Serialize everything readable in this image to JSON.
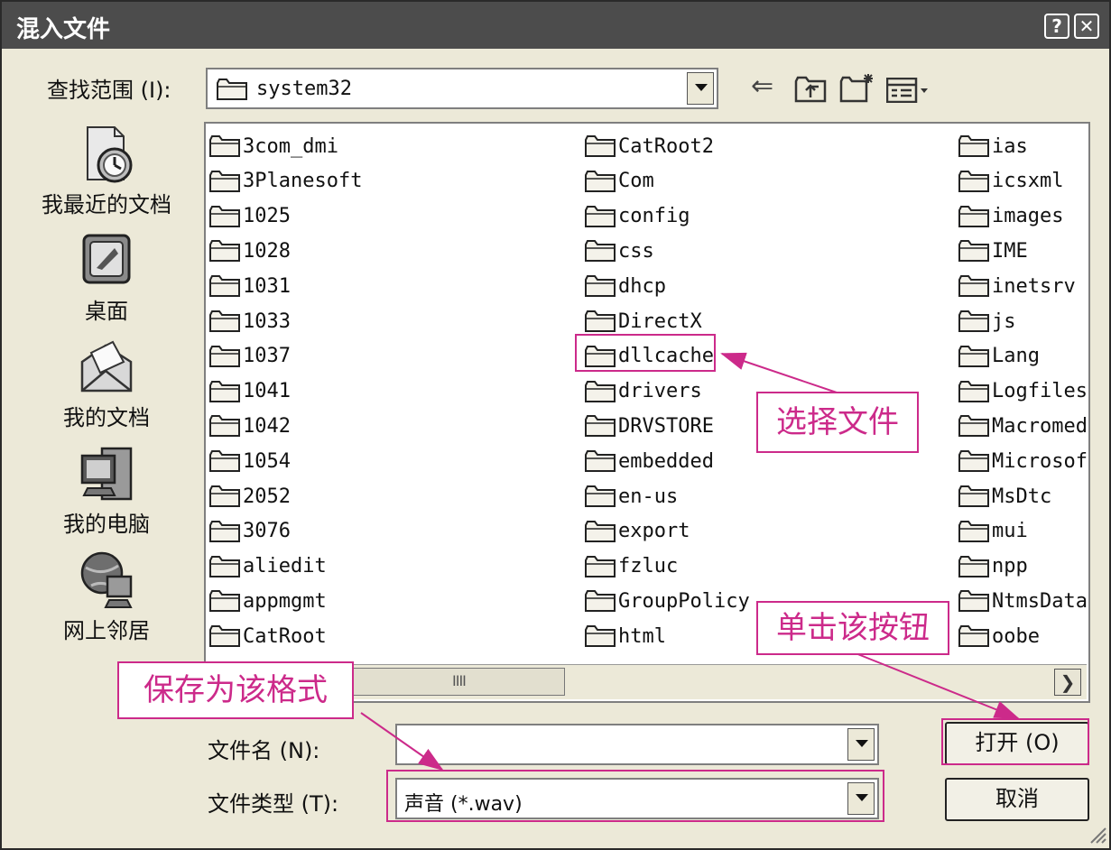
{
  "window": {
    "title": "混入文件",
    "help_label": "?",
    "close_label": "✕"
  },
  "lookin": {
    "label": "查找范围 (I):",
    "value": "system32"
  },
  "places": [
    {
      "label": "我最近的文档",
      "icon": "recent-documents-icon"
    },
    {
      "label": "桌面",
      "icon": "desktop-icon"
    },
    {
      "label": "我的文档",
      "icon": "my-documents-icon"
    },
    {
      "label": "我的电脑",
      "icon": "my-computer-icon"
    },
    {
      "label": "网上邻居",
      "icon": "network-places-icon"
    }
  ],
  "columns": [
    [
      "3com_dmi",
      "3Planesoft",
      "1025",
      "1028",
      "1031",
      "1033",
      "1037",
      "1041",
      "1042",
      "1054",
      "2052",
      "3076",
      "aliedit",
      "appmgmt",
      "CatRoot"
    ],
    [
      "CatRoot2",
      "Com",
      "config",
      "css",
      "dhcp",
      "DirectX",
      "dllcache",
      "drivers",
      "DRVSTORE",
      "embedded",
      "en-us",
      "export",
      "fzluc",
      "GroupPolicy",
      "html"
    ],
    [
      "ias",
      "icsxml",
      "images",
      "IME",
      "inetsrv",
      "js",
      "Lang",
      "Logfiles",
      "Macromed",
      "Microsof",
      "MsDtc",
      "mui",
      "npp",
      "NtmsData",
      "oobe"
    ]
  ],
  "filename": {
    "label": "文件名 (N):",
    "value": ""
  },
  "filetype": {
    "label": "文件类型 (T):",
    "value": "声音 (*.wav)"
  },
  "buttons": {
    "open": "打开 (O)",
    "cancel": "取消"
  },
  "scroll": {
    "thumb_grip": "IIII",
    "right_arrow": "❯"
  },
  "callouts": {
    "select_file": "选择文件",
    "click_button": "单击该按钮",
    "save_format": "保存为该格式"
  },
  "colors": {
    "accent": "#cc2a8a",
    "titlebar": "#4c4c4c",
    "background": "#ece9d8"
  }
}
